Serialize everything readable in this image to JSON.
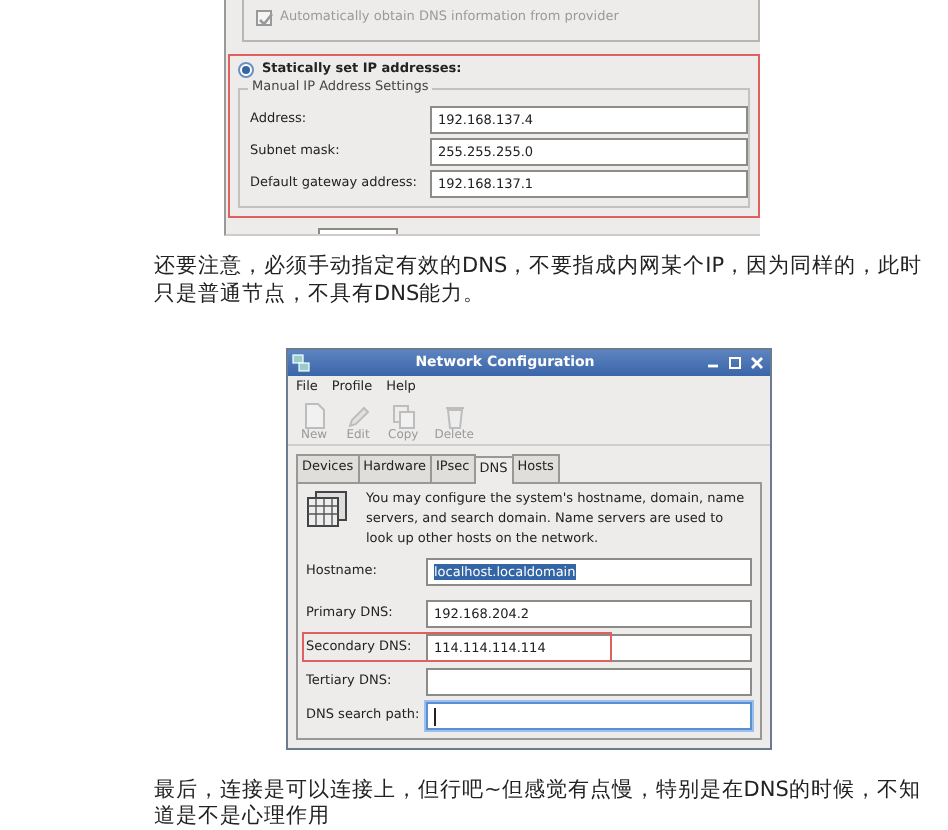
{
  "ip_settings_dialog": {
    "dns_option": {
      "label": "Automatically obtain DNS information from provider",
      "checked": true,
      "disabled": true
    },
    "static_option": {
      "label": "Statically set IP addresses:",
      "selected": true,
      "annotated": true
    },
    "group_title": "Manual IP Address Settings",
    "fields": [
      {
        "label": "Address:",
        "value": "192.168.137.4"
      },
      {
        "label": "Subnet mask:",
        "value": "255.255.255.0"
      },
      {
        "label": "Default gateway address:",
        "value": "192.168.137.1"
      }
    ]
  },
  "note_1": "还要注意，必须手动指定有效的DNS，不要指成内网某个IP，因为同样的，此时只是普通节点，不具有DNS能力。",
  "network_config_window": {
    "title": "Network Configuration",
    "menu": [
      "File",
      "Profile",
      "Help"
    ],
    "toolbar": [
      {
        "label": "New",
        "disabled": true
      },
      {
        "label": "Edit",
        "disabled": true
      },
      {
        "label": "Copy",
        "disabled": true
      },
      {
        "label": "Delete",
        "disabled": true
      }
    ],
    "tabs": [
      {
        "label": "Devices",
        "selected": false
      },
      {
        "label": "Hardware",
        "selected": false
      },
      {
        "label": "IPsec",
        "selected": false
      },
      {
        "label": "DNS",
        "selected": true
      },
      {
        "label": "Hosts",
        "selected": false
      }
    ],
    "info_text": "You may configure the system's hostname, domain, name servers, and search domain. Name servers are used to look up other hosts on the network.",
    "hostname": {
      "label": "Hostname:",
      "value": "localhost.localdomain",
      "text_selected": true
    },
    "dns_fields": [
      {
        "label": "Primary DNS:",
        "value": "192.168.204.2",
        "annotated": false,
        "focused": false
      },
      {
        "label": "Secondary DNS:",
        "value": "114.114.114.114",
        "annotated": true,
        "focused": false
      },
      {
        "label": "Tertiary DNS:",
        "annotated": false,
        "focused": false
      },
      {
        "label": "DNS search path:",
        "annotated": false,
        "focused": true
      }
    ]
  },
  "note_2": "最后，连接是可以连接上，但行吧~但感觉有点慢，特别是在DNS的时候，不知道是不是心理作用"
}
